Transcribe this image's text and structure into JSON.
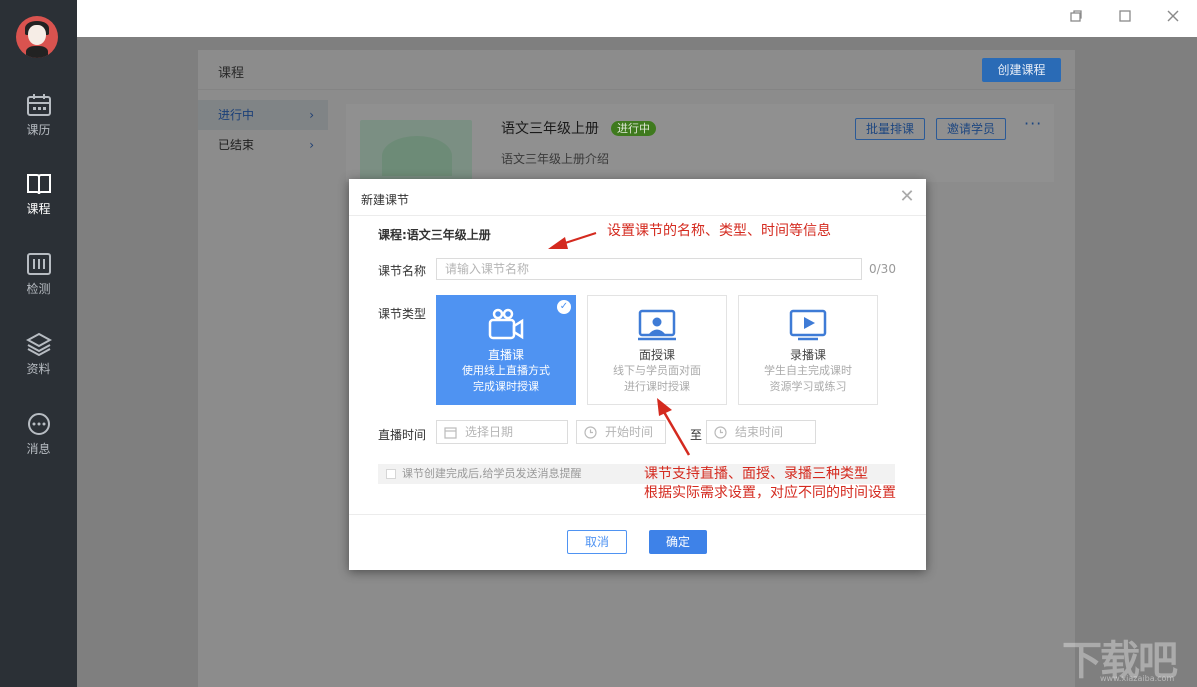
{
  "window": {
    "restore_icon": "restore-icon",
    "maximize_icon": "maximize-icon",
    "close_icon": "close-icon"
  },
  "nav": {
    "items": [
      {
        "label": "课历",
        "icon": "calendar-icon",
        "active": false
      },
      {
        "label": "课程",
        "icon": "book-icon",
        "active": true
      },
      {
        "label": "检测",
        "icon": "test-icon",
        "active": false
      },
      {
        "label": "资料",
        "icon": "layers-icon",
        "active": false
      },
      {
        "label": "消息",
        "icon": "message-icon",
        "active": false
      }
    ]
  },
  "page": {
    "title": "课程",
    "create_button": "创建课程",
    "subnav": [
      {
        "label": "进行中",
        "active": true
      },
      {
        "label": "已结束",
        "active": false
      }
    ],
    "course": {
      "name": "语文三年级上册",
      "badge": "进行中",
      "description": "语文三年级上册介绍",
      "batch_button": "批量排课",
      "invite_button": "邀请学员",
      "more": "···"
    }
  },
  "modal": {
    "title": "新建课节",
    "course_line": "课程:语文三年级上册",
    "name_label": "课节名称",
    "name_placeholder": "请输入课节名称",
    "name_counter": "0/30",
    "type_label": "课节类型",
    "types": [
      {
        "name": "直播课",
        "desc_line1": "使用线上直播方式",
        "desc_line2": "完成课时授课",
        "selected": true,
        "icon": "video-camera-icon"
      },
      {
        "name": "面授课",
        "desc_line1": "线下与学员面对面",
        "desc_line2": "进行课时授课",
        "selected": false,
        "icon": "classroom-icon"
      },
      {
        "name": "录播课",
        "desc_line1": "学生自主完成课时",
        "desc_line2": "资源学习或练习",
        "selected": false,
        "icon": "play-video-icon"
      }
    ],
    "time_label": "直播时间",
    "date_placeholder": "选择日期",
    "start_placeholder": "开始时间",
    "to_label": "至",
    "end_placeholder": "结束时间",
    "notify_text": "课节创建完成后,给学员发送消息提醒",
    "cancel_button": "取消",
    "ok_button": "确定"
  },
  "annotations": {
    "top": "设置课节的名称、类型、时间等信息",
    "bottom_line1": "课节支持直播、面授、录播三种类型",
    "bottom_line2": "根据实际需求设置，对应不同的时间设置",
    "color": "#d42a1f"
  },
  "watermark": {
    "text": "下载吧",
    "url": "www.xiazaiba.com"
  }
}
